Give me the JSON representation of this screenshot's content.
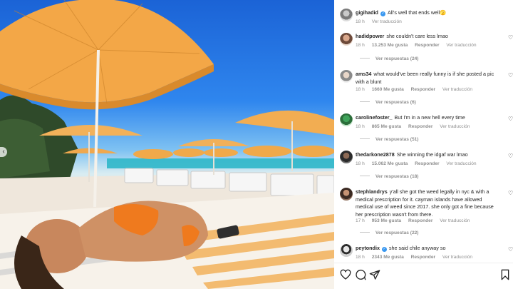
{
  "caption": {
    "username": "gigihadid",
    "text": "All's well that ends well🫣",
    "time": "18 h",
    "translate": "Ver traducción"
  },
  "comments": [
    {
      "username": "hadidpower",
      "text": "she couldn't care less lmao",
      "time": "18 h",
      "likes": "13.253 Me gusta",
      "reply": "Responder",
      "translate": "Ver traducción",
      "replies": "Ver respuestas (24)"
    },
    {
      "username": "ams34",
      "text": "what would've been really funny is if she posted a pic with a blunt",
      "time": "18 h",
      "likes": "1660 Me gusta",
      "reply": "Responder",
      "translate": "Ver traducción",
      "replies": "Ver respuestas (6)"
    },
    {
      "username": "carolinefoster_",
      "text": "But I'm in a new hell every time",
      "time": "18 h",
      "likes": "865 Me gusta",
      "reply": "Responder",
      "translate": "Ver traducción",
      "replies": "Ver respuestas (51)"
    },
    {
      "username": "thedarkone2878",
      "text": "She winning the idgaf war lmao",
      "time": "18 h",
      "likes": "15.062 Me gusta",
      "reply": "Responder",
      "translate": "Ver traducción",
      "replies": "Ver respuestas (18)"
    },
    {
      "username": "stephlandrys",
      "text": "y'all she got the weed legally in nyc & with a medical prescription for it. cayman islands have allowed medical use of weed since 2017. she only got a fine because her prescription wasn't from there.",
      "time": "17 h",
      "likes": "953 Me gusta",
      "reply": "Responder",
      "translate": "Ver traducción",
      "replies": "Ver respuestas (22)"
    },
    {
      "username": "peytondix",
      "text": "she said chile anyway so",
      "time": "18 h",
      "likes": "2343 Me gusta",
      "reply": "Responder",
      "translate": "Ver traducción"
    }
  ],
  "icons": {
    "like": "heart-icon",
    "comment": "comment-icon",
    "share": "send-icon",
    "save": "bookmark-icon",
    "comment_like": "heart-small-icon"
  },
  "colors": {
    "text": "#262626",
    "muted": "#8e8e8e",
    "verified": "#3897f0"
  }
}
